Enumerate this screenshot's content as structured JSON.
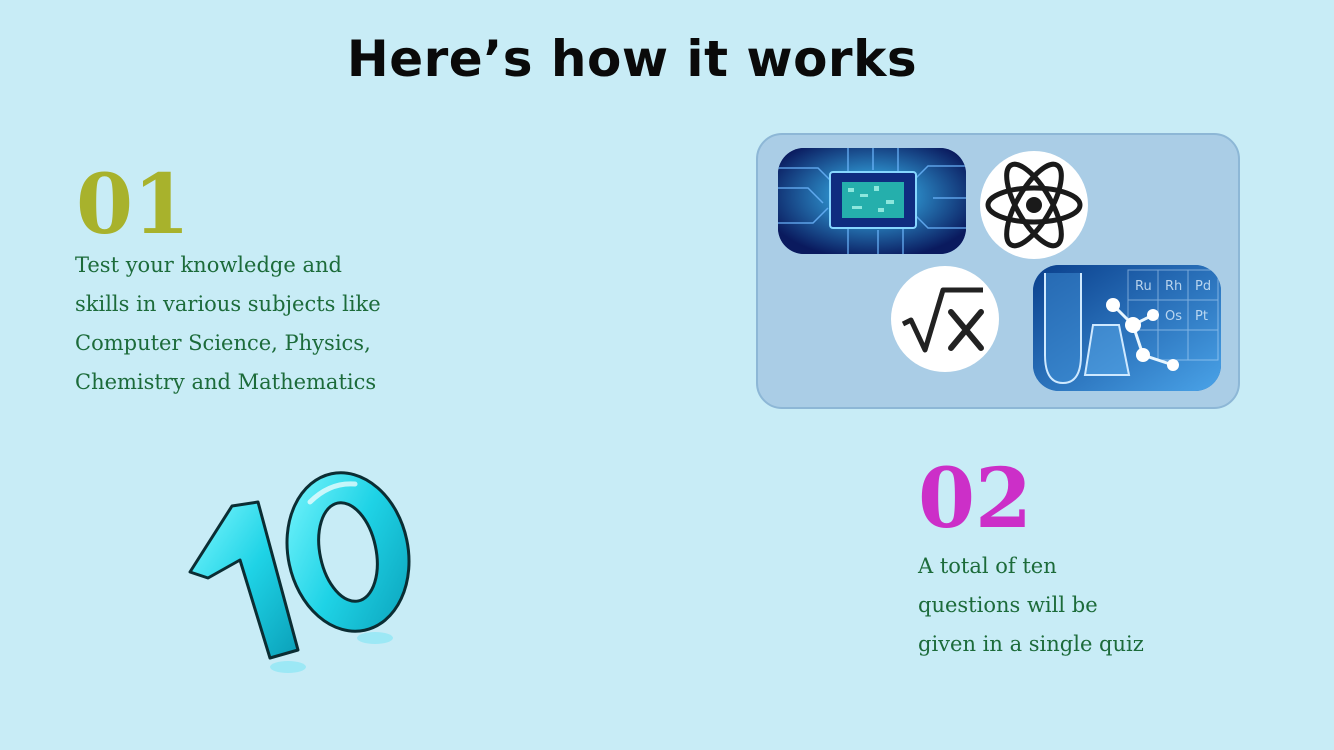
{
  "header": {
    "title": "Here’s how it works"
  },
  "steps": [
    {
      "number": "01",
      "number_color": "#a8b22c",
      "lines": [
        "Test your knowledge and",
        "skills in various subjects like",
        "Computer Science, Physics,",
        "Chemistry and Mathematics"
      ]
    },
    {
      "number": "02",
      "number_color": "#cc2fc8",
      "lines": [
        "A total of ten",
        "questions will be",
        "given in a single quiz"
      ]
    }
  ],
  "ten_graphic": {
    "text": "10"
  },
  "subject_images": [
    {
      "subject": "Computer Science",
      "icon": "circuit-chip-icon"
    },
    {
      "subject": "Physics",
      "icon": "atom-icon"
    },
    {
      "subject": "Mathematics",
      "icon": "square-root-icon"
    },
    {
      "subject": "Chemistry",
      "icon": "lab-flask-icon"
    }
  ],
  "colors": {
    "background": "#c8ecf6",
    "step_text": "#1c6b3a",
    "panel": "#aacde6"
  }
}
